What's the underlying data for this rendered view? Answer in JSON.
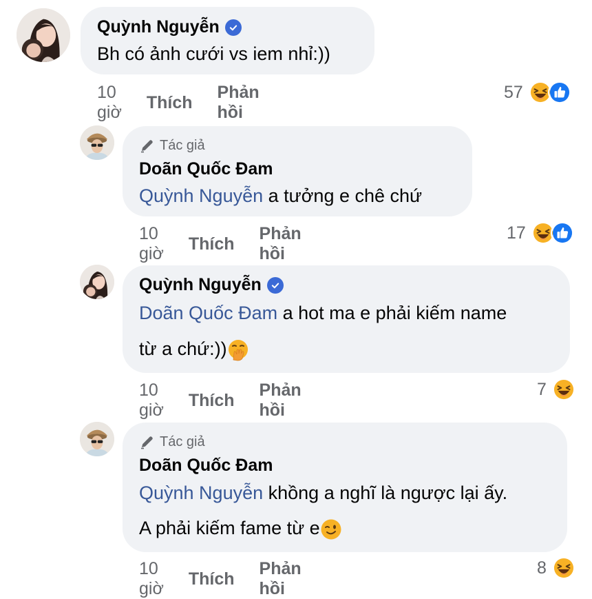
{
  "comments": [
    {
      "author": "Quỳnh Nguyễn",
      "verified": true,
      "text": "Bh có ảnh cưới vs iem nhỉ:))",
      "time": "10 giờ",
      "like": "Thích",
      "reply": "Phản hồi",
      "reaction_count": "57",
      "reactions": [
        "haha-icon",
        "like-icon"
      ]
    },
    {
      "author_tag": "Tác giả",
      "author": "Doãn Quốc Đam",
      "mention": "Quỳnh Nguyễn",
      "text": " a tưởng e chê chứ",
      "time": "10 giờ",
      "like": "Thích",
      "reply": "Phản hồi",
      "reaction_count": "17",
      "reactions": [
        "haha-icon",
        "like-icon"
      ]
    },
    {
      "author": "Quỳnh Nguyễn",
      "verified": true,
      "mention": "Doãn Quốc Đam",
      "text_line1": " a hot ma e phải kiếm name",
      "text_line2": "từ a chứ:))",
      "emoji": "hand-over-mouth-emoji",
      "time": "10 giờ",
      "like": "Thích",
      "reply": "Phản hồi",
      "reaction_count": "7",
      "reactions": [
        "haha-icon"
      ]
    },
    {
      "author_tag": "Tác giả",
      "author": "Doãn Quốc Đam",
      "mention": "Quỳnh Nguyễn",
      "text_line1": " khồng a nghĩ là ngược lại ấy.",
      "text_line2": "A phải kiếm fame từ e",
      "emoji": "winking-face-emoji",
      "time": "10 giờ",
      "like": "Thích",
      "reply": "Phản hồi",
      "reaction_count": "8",
      "reactions": [
        "haha-icon"
      ]
    }
  ],
  "colors": {
    "bubble": "#f0f2f5",
    "mention": "#385898",
    "meta": "#65676b",
    "verified": "#3b6ad6",
    "like_reaction": "#1877f2",
    "haha_reaction": "#f7b125"
  }
}
